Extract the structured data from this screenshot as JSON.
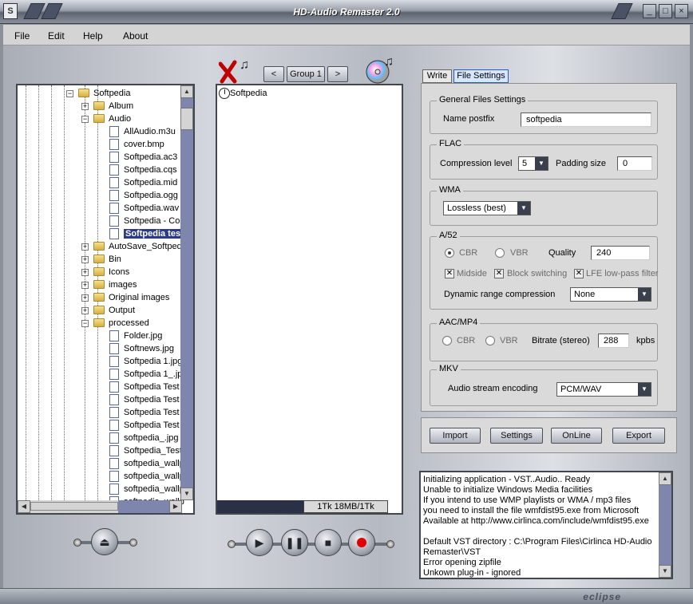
{
  "window": {
    "title": "HD-Audio Remaster 2.0",
    "controls": {
      "minimize": "_",
      "maximize": "□",
      "close": "×"
    }
  },
  "menu": [
    "File",
    "Edit",
    "Help",
    "About"
  ],
  "toolbar": {
    "group_prev": "<",
    "group_label": "Group 1",
    "group_next": ">"
  },
  "tree": [
    {
      "label": "Softpedia",
      "level": 0,
      "type": "folder",
      "expander": "−"
    },
    {
      "label": "Album",
      "level": 1,
      "type": "folder",
      "expander": "+"
    },
    {
      "label": "Audio",
      "level": 1,
      "type": "folder",
      "expander": "−"
    },
    {
      "label": "AllAudio.m3u",
      "level": 2,
      "type": "file"
    },
    {
      "label": "cover.bmp",
      "level": 2,
      "type": "file"
    },
    {
      "label": "Softpedia.ac3",
      "level": 2,
      "type": "file"
    },
    {
      "label": "Softpedia.cqs",
      "level": 2,
      "type": "file"
    },
    {
      "label": "Softpedia.mid",
      "level": 2,
      "type": "file"
    },
    {
      "label": "Softpedia.ogg",
      "level": 2,
      "type": "file"
    },
    {
      "label": "Softpedia.wav",
      "level": 2,
      "type": "file"
    },
    {
      "label": "Softpedia - Cop",
      "level": 2,
      "type": "file"
    },
    {
      "label": "Softpedia tes",
      "level": 2,
      "type": "file",
      "selected": true
    },
    {
      "label": "AutoSave_Softped",
      "level": 1,
      "type": "folder",
      "expander": "+"
    },
    {
      "label": "Bin",
      "level": 1,
      "type": "folder",
      "expander": "+"
    },
    {
      "label": "Icons",
      "level": 1,
      "type": "folder",
      "expander": "+"
    },
    {
      "label": "images",
      "level": 1,
      "type": "folder",
      "expander": "+"
    },
    {
      "label": "Original images",
      "level": 1,
      "type": "folder",
      "expander": "+"
    },
    {
      "label": "Output",
      "level": 1,
      "type": "folder",
      "expander": "+"
    },
    {
      "label": "processed",
      "level": 1,
      "type": "folder",
      "expander": "−"
    },
    {
      "label": "Folder.jpg",
      "level": 2,
      "type": "file"
    },
    {
      "label": "Softnews.jpg",
      "level": 2,
      "type": "file"
    },
    {
      "label": "Softpedia 1.jpg",
      "level": 2,
      "type": "file"
    },
    {
      "label": "Softpedia 1_.jp",
      "level": 2,
      "type": "file"
    },
    {
      "label": "Softpedia Test",
      "level": 2,
      "type": "file"
    },
    {
      "label": "Softpedia Test",
      "level": 2,
      "type": "file"
    },
    {
      "label": "Softpedia Test",
      "level": 2,
      "type": "file"
    },
    {
      "label": "Softpedia Test",
      "level": 2,
      "type": "file"
    },
    {
      "label": "softpedia_.jpg",
      "level": 2,
      "type": "file"
    },
    {
      "label": "Softpedia_Test",
      "level": 2,
      "type": "file"
    },
    {
      "label": "softpedia_wallp",
      "level": 2,
      "type": "file"
    },
    {
      "label": "softpedia_wallp",
      "level": 2,
      "type": "file"
    },
    {
      "label": "softpedia_wallp",
      "level": 2,
      "type": "file"
    },
    {
      "label": "softpedia_wallp",
      "level": 2,
      "type": "file"
    }
  ],
  "track_list": {
    "items": [
      "Softpedia"
    ],
    "status": "1Tk 18MB/1Tk"
  },
  "tabs": [
    "Write",
    "File Settings"
  ],
  "active_tab": "File Settings",
  "settings": {
    "general": {
      "title": "General Files Settings",
      "name_postfix_label": "Name postfix",
      "name_postfix_value": "softpedia"
    },
    "flac": {
      "title": "FLAC",
      "compression_label": "Compression level",
      "compression_value": "5",
      "padding_label": "Padding size",
      "padding_value": "0"
    },
    "wma": {
      "title": "WMA",
      "mode_value": "Lossless (best)"
    },
    "a52": {
      "title": "A/52",
      "cbr": "CBR",
      "vbr": "VBR",
      "mode_selected": "CBR",
      "quality_label": "Quality",
      "quality_value": "240",
      "midside": "Midside",
      "block_switching": "Block switching",
      "lfe": "LFE low-pass filter",
      "drc_label": "Dynamic range compression",
      "drc_value": "None"
    },
    "aac": {
      "title": "AAC/MP4",
      "cbr": "CBR",
      "vbr": "VBR",
      "bitrate_label": "Bitrate (stereo)",
      "bitrate_value": "288",
      "unit": "kpbs"
    },
    "mkv": {
      "title": "MKV",
      "encoding_label": "Audio stream encoding",
      "encoding_value": "PCM/WAV"
    }
  },
  "actions": {
    "import": "Import",
    "settings": "Settings",
    "online": "OnLine",
    "export": "Export"
  },
  "log": [
    "Initializing application - VST..Audio.. Ready",
    "Unable to initialize Windows Media facilities",
    "If you intend to use WMP playlists or WMA / mp3 files",
    "you need to install the file wmfdist95.exe from Microsoft",
    "Available at http://www.cirlinca.com/include/wmfdist95.exe",
    "",
    "Default VST directory : C:\\Program Files\\Cirlinca HD-Audio",
    "Remaster\\VST",
    "Error opening zipfile",
    "Unkown plug-in - ignored"
  ],
  "footer": {
    "brand": "eclipse"
  },
  "icons": {
    "remove": "remove-x-icon",
    "cd": "cd-music-icon",
    "eject": "eject-icon",
    "play": "play-icon",
    "pause": "pause-icon",
    "stop": "stop-icon",
    "record": "record-icon"
  },
  "colors": {
    "record": "#e00000",
    "scroll_track": "#7f86ad",
    "selection": "#2c3a8c"
  }
}
